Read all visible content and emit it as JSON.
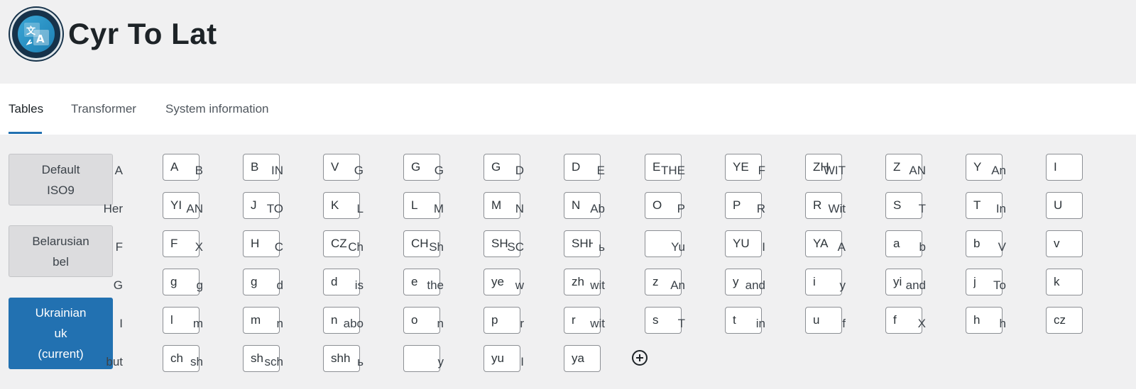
{
  "app": {
    "title": "Cyr To Lat",
    "logo_icon": "translate-logo-icon"
  },
  "tabs": [
    "Tables",
    "Transformer",
    "System information"
  ],
  "locales": [
    {
      "lines": [
        "Default",
        "ISO9"
      ],
      "current": false
    },
    {
      "lines": [
        "Belarusian",
        "bel"
      ],
      "current": false
    },
    {
      "lines": [
        "Ukrainian",
        "uk",
        "(current)"
      ],
      "current": true
    }
  ],
  "colors": {
    "accent": "#2271b1",
    "background": "#f0f0f1"
  },
  "table": {
    "rows": [
      [
        [
          "A",
          "A"
        ],
        [
          "B",
          "B"
        ],
        [
          "IN",
          "V"
        ],
        [
          "G",
          "G"
        ],
        [
          "G",
          "G"
        ],
        [
          "D",
          "D"
        ],
        [
          "E",
          "E"
        ],
        [
          "THE",
          "YE"
        ],
        [
          "F",
          "ZH"
        ],
        [
          "WIT",
          "Z"
        ],
        [
          "AN",
          "Y"
        ],
        [
          "An",
          "I"
        ]
      ],
      [
        [
          "Her",
          "YI"
        ],
        [
          "AN",
          "J"
        ],
        [
          "TO",
          "K"
        ],
        [
          "L",
          "L"
        ],
        [
          "M",
          "M"
        ],
        [
          "N",
          "N"
        ],
        [
          "Ab",
          "O"
        ],
        [
          "P",
          "P"
        ],
        [
          "R",
          "R"
        ],
        [
          "Wit",
          "S"
        ],
        [
          "T",
          "T"
        ],
        [
          "In",
          "U"
        ]
      ],
      [
        [
          "F",
          "F"
        ],
        [
          "X",
          "H"
        ],
        [
          "C",
          "CZ"
        ],
        [
          "Ch",
          "CH"
        ],
        [
          "Sh",
          "SH"
        ],
        [
          "SC",
          "SHH"
        ],
        [
          "ь",
          ""
        ],
        [
          "Yu",
          "YU"
        ],
        [
          "I",
          "YA"
        ],
        [
          "A",
          "a"
        ],
        [
          "b",
          "b"
        ],
        [
          "V",
          "v"
        ]
      ],
      [
        [
          "G",
          "g"
        ],
        [
          "g",
          "g"
        ],
        [
          "d",
          "d"
        ],
        [
          "is",
          "e"
        ],
        [
          "the",
          "ye"
        ],
        [
          "w",
          "zh"
        ],
        [
          "wit",
          "z"
        ],
        [
          "An",
          "y"
        ],
        [
          "and",
          "i"
        ],
        [
          "y",
          "yi"
        ],
        [
          "and",
          "j"
        ],
        [
          "To",
          "k"
        ]
      ],
      [
        [
          "I",
          "l"
        ],
        [
          "m",
          "m"
        ],
        [
          "n",
          "n"
        ],
        [
          "abo",
          "o"
        ],
        [
          "n",
          "p"
        ],
        [
          "r",
          "r"
        ],
        [
          "wit",
          "s"
        ],
        [
          "T",
          "t"
        ],
        [
          "in",
          "u"
        ],
        [
          "f",
          "f"
        ],
        [
          "X",
          "h"
        ],
        [
          "h",
          "cz"
        ]
      ],
      [
        [
          "but",
          "ch"
        ],
        [
          "sh",
          "sh"
        ],
        [
          "sch",
          "shh"
        ],
        [
          "ь",
          ""
        ],
        [
          "y",
          "yu"
        ],
        [
          "I",
          "ya"
        ]
      ]
    ],
    "add_icon": "plus-circle-icon"
  }
}
